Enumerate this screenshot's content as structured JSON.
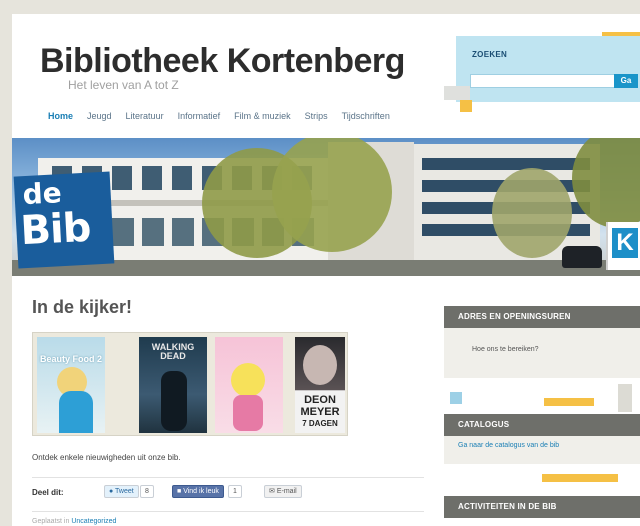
{
  "site": {
    "title": "Bibliotheek Kortenberg",
    "tagline": "Het leven van A tot Z"
  },
  "search": {
    "label": "ZOEKEN",
    "placeholder": "",
    "button": "Ga"
  },
  "nav": {
    "items": [
      "Home",
      "Jeugd",
      "Literatuur",
      "Informatief",
      "Film & muziek",
      "Strips",
      "Tijdschriften"
    ],
    "active": "Home"
  },
  "banner": {
    "logo_de": "de",
    "logo_bib": "Bib",
    "k_logo": "K"
  },
  "main": {
    "heading": "In de kijker!",
    "books": [
      {
        "title": "Beauty Food 2"
      },
      {
        "title": "WALKING DEAD"
      },
      {
        "title": ""
      },
      {
        "title_line1": "DEON",
        "title_line2": "MEYER",
        "title_line3": "7 DAGEN"
      }
    ],
    "caption": "Ontdek enkele nieuwigheden uit onze bib.",
    "share": {
      "label": "Deel dit:",
      "tweet": "Tweet",
      "tweet_count": "8",
      "facebook": "Vind ik leuk",
      "facebook_count": "1",
      "email": "E-mail"
    },
    "filed": {
      "prefix": "Geplaatst in",
      "category": "Uncategorized"
    }
  },
  "sidebar": {
    "widgets": [
      {
        "title": "ADRES EN OPENINGSUREN",
        "link": "Hoe ons te bereiken?"
      },
      {
        "title": "CATALOGUS",
        "link": "Ga naar de catalogus van de bib"
      },
      {
        "title": "ACTIVITEITEN IN DE BIB"
      }
    ]
  },
  "colors": {
    "nav_active": "#1a7fb5",
    "widget_header": "#6e6f6a",
    "search_bg": "#bfe4f1",
    "accent_yellow": "#f5c045",
    "logo_blue": "#1a5d9c"
  }
}
